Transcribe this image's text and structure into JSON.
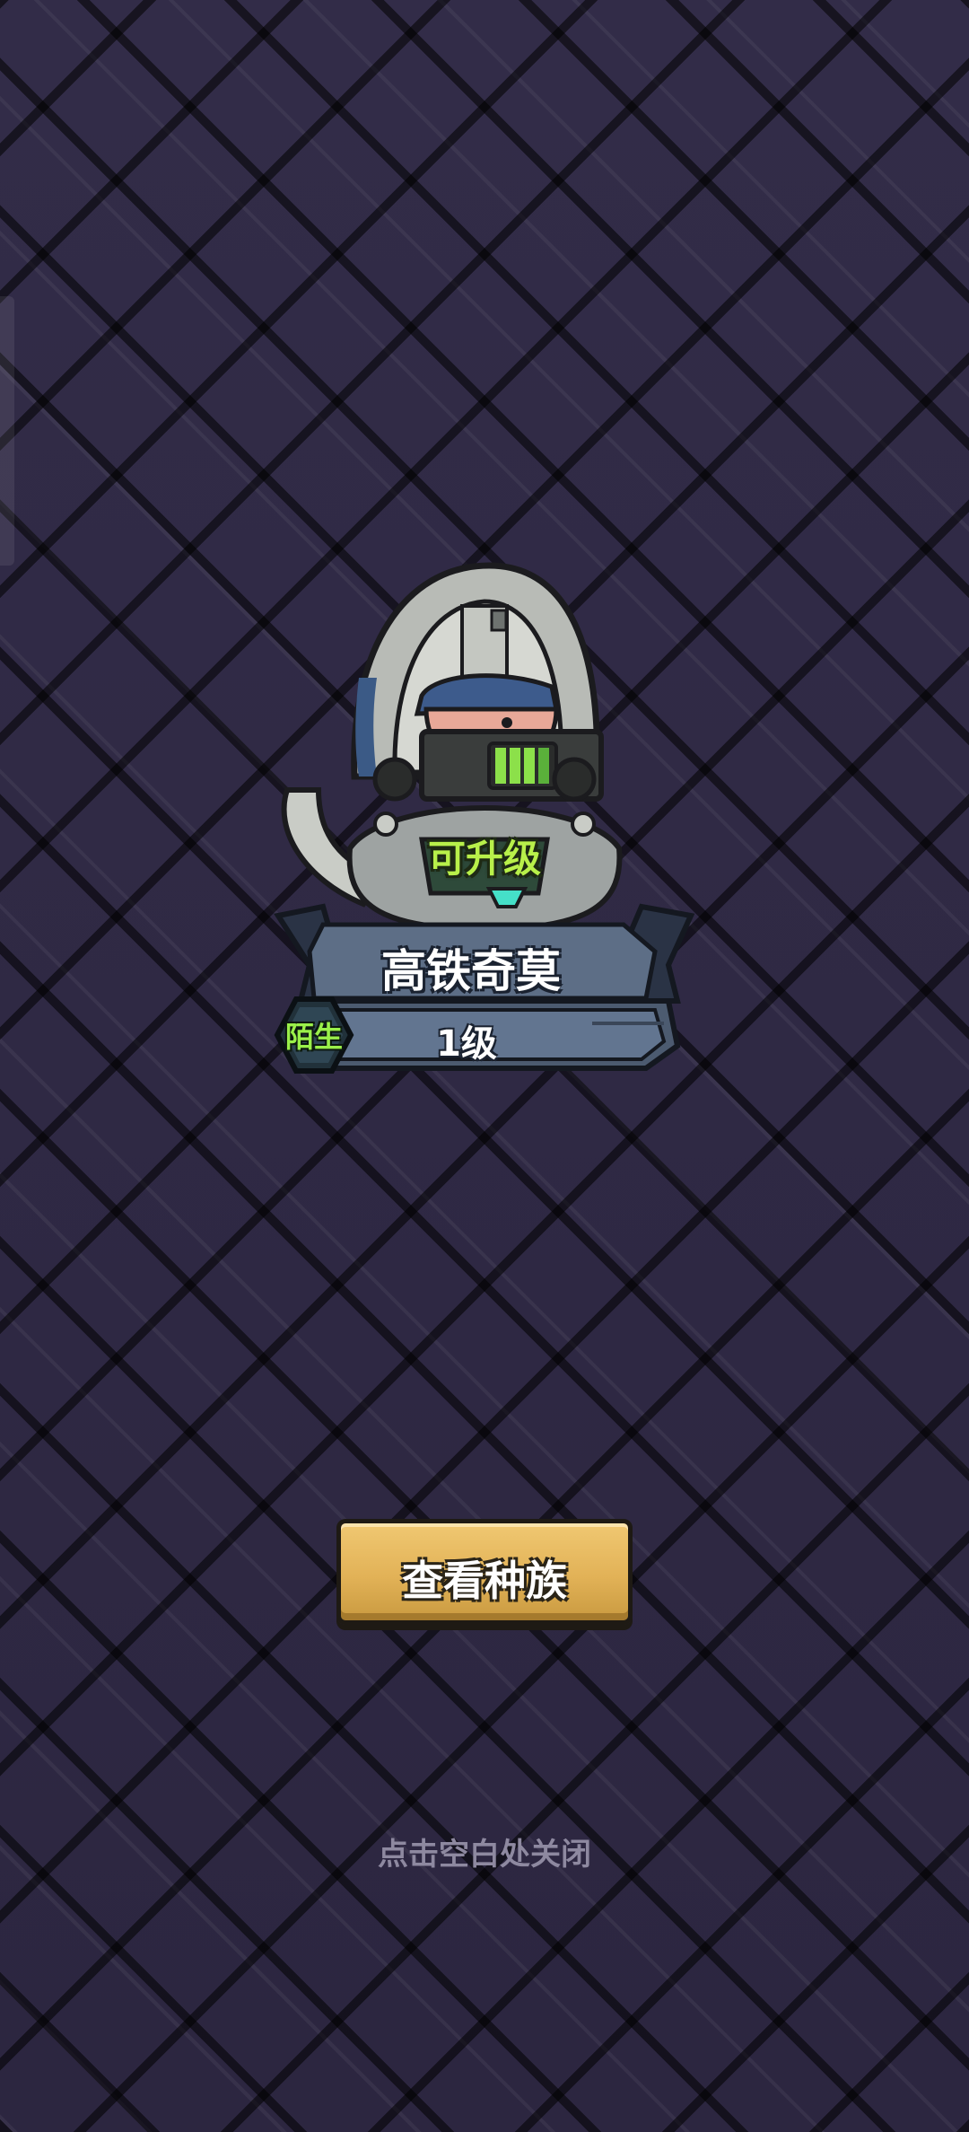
{
  "character": {
    "status_tag": "可升级",
    "name": "高铁奇莫",
    "level": "1级",
    "relation": "陌生"
  },
  "actions": {
    "view_race_label": "查看种族"
  },
  "hint": {
    "close_text": "点击空白处关闭"
  },
  "icons": {
    "character_art": "armored-creature-portrait"
  },
  "colors": {
    "background": "#2f2942",
    "upgrade_green": "#b8f04a",
    "button_gold": "#e2b257",
    "plate_steel": "#5d6e86"
  }
}
